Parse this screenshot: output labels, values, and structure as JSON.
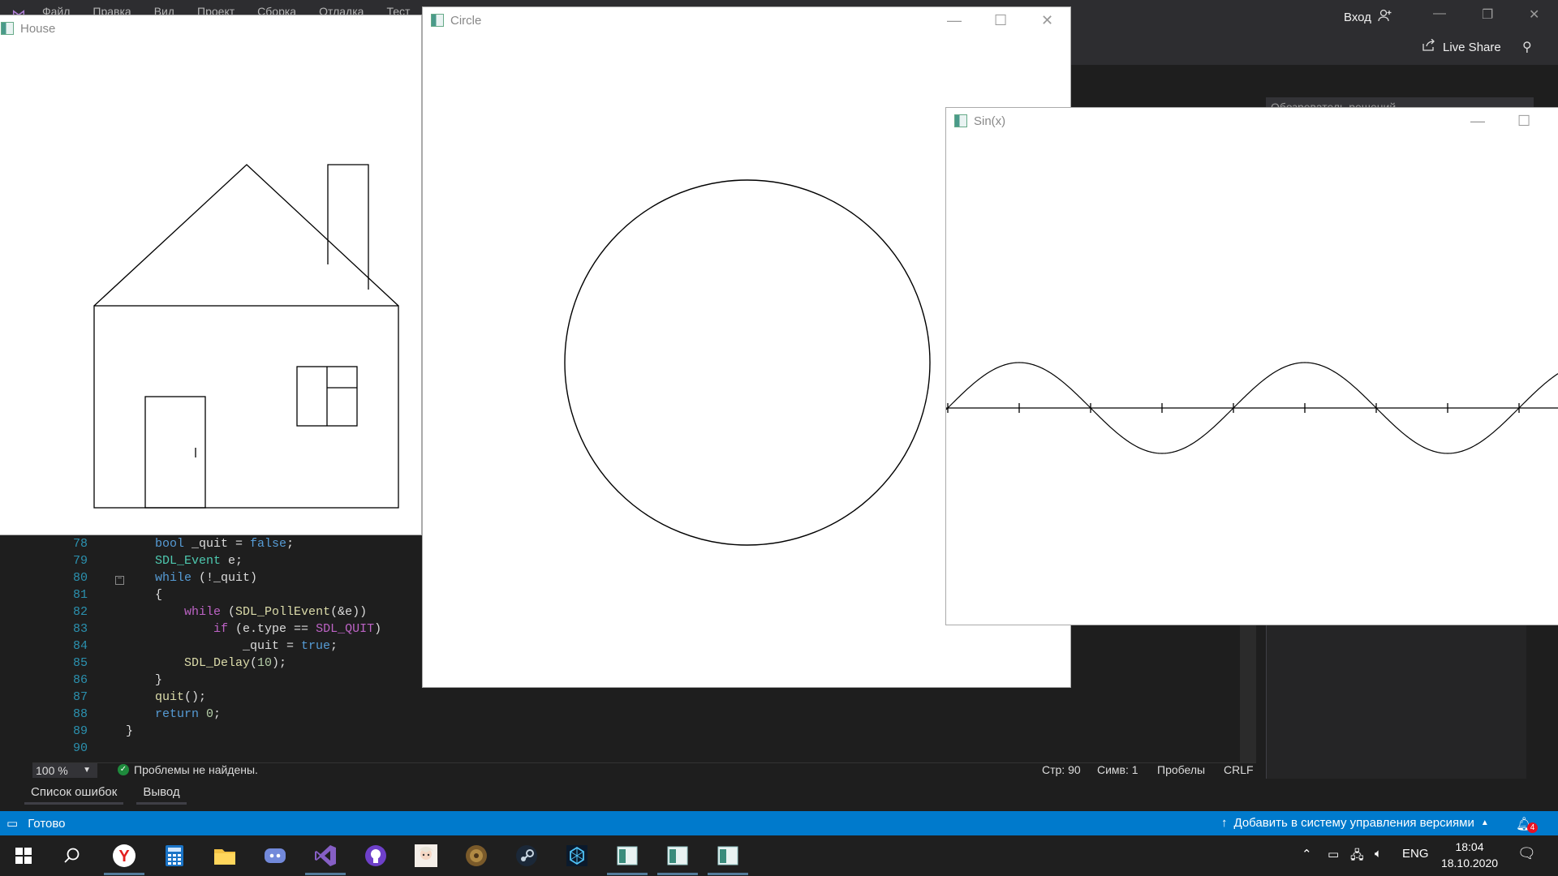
{
  "vs": {
    "menu": [
      "Файл",
      "Правка",
      "Вид",
      "Проект",
      "Сборка",
      "Отладка",
      "Тест"
    ],
    "signin": "Вход",
    "live_share": "Live Share",
    "solution_search_placeholder": "Обозреватель решений",
    "code_lines": [
      {
        "num": "78",
        "code": "bool _quit = false;"
      },
      {
        "num": "79",
        "code": "SDL_Event e;"
      },
      {
        "num": "80",
        "code": "while (!_quit)"
      },
      {
        "num": "81",
        "code": "{"
      },
      {
        "num": "82",
        "code": "while (SDL_PollEvent(&e))"
      },
      {
        "num": "83",
        "code": "if (e.type == SDL_QUIT)"
      },
      {
        "num": "84",
        "code": "_quit = true;"
      },
      {
        "num": "85",
        "code": "SDL_Delay(10);"
      },
      {
        "num": "86",
        "code": "}"
      },
      {
        "num": "87",
        "code": "quit();"
      },
      {
        "num": "88",
        "code": "return 0;"
      },
      {
        "num": "89",
        "code": "}"
      },
      {
        "num": "90",
        "code": ""
      }
    ],
    "zoom": "100 %",
    "problems": "Проблемы не найдены.",
    "line_info": "Стр: 90",
    "col_info": "Симв: 1",
    "spaces": "Пробелы",
    "eol": "CRLF",
    "bottom_tabs": [
      "Список ошибок",
      "Вывод"
    ],
    "status_ready": "Готово",
    "status_vcs": "Добавить в систему управления версиями",
    "notifications": "4"
  },
  "windows": {
    "house": {
      "title": "House"
    },
    "circle": {
      "title": "Circle"
    },
    "sin": {
      "title": "Sin(x)"
    }
  },
  "taskbar": {
    "lang": "ENG",
    "time": "18:04",
    "date": "18.10.2020",
    "pinned": [
      "windows-start",
      "search",
      "yandex-browser",
      "calculator",
      "file-explorer",
      "discord",
      "visual-studio",
      "github-desktop",
      "game-app",
      "game-app-2",
      "steam",
      "sdl-app-1",
      "sdl-app-2",
      "sdl-app-3",
      "sdl-app-4"
    ]
  },
  "colors": {
    "vs_blue": "#007acc",
    "editor_bg": "#1e1e1e",
    "taskbar_bg": "#1f1f1f"
  }
}
